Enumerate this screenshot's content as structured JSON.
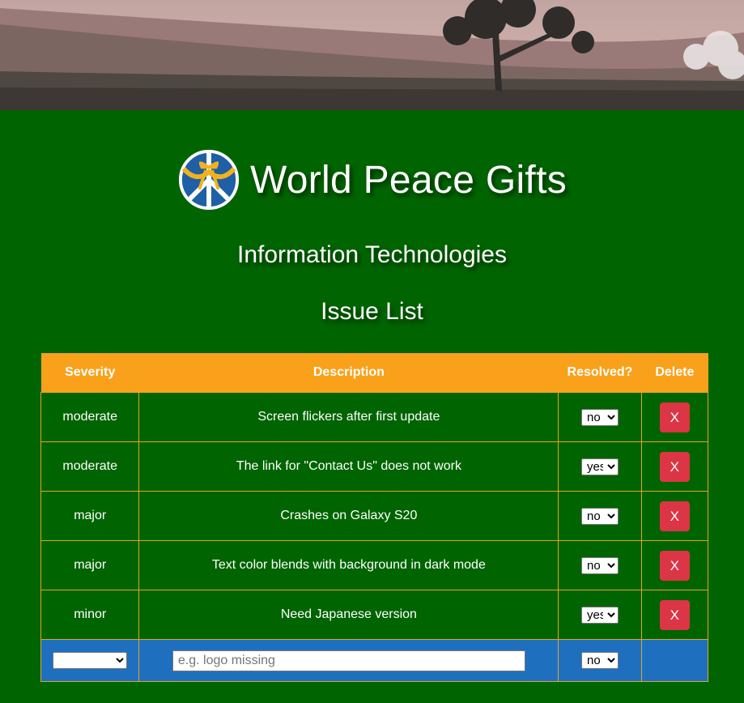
{
  "brand": {
    "title": "World Peace Gifts",
    "logo_icon": "peace-ribbon-logo-icon"
  },
  "header": {
    "subtitle": "Information Technologies",
    "section_title": "Issue List"
  },
  "table": {
    "columns": {
      "severity": "Severity",
      "description": "Description",
      "resolved": "Resolved?",
      "delete": "Delete"
    },
    "rows": [
      {
        "severity": "moderate",
        "description": "Screen flickers after first update",
        "resolved": "no",
        "delete_label": "X"
      },
      {
        "severity": "moderate",
        "description": "The link for \"Contact Us\" does not work",
        "resolved": "yes",
        "delete_label": "X"
      },
      {
        "severity": "major",
        "description": "Crashes on Galaxy S20",
        "resolved": "no",
        "delete_label": "X"
      },
      {
        "severity": "major",
        "description": "Text color blends with background in dark mode",
        "resolved": "no",
        "delete_label": "X"
      },
      {
        "severity": "minor",
        "description": "Need Japanese version",
        "resolved": "yes",
        "delete_label": "X"
      }
    ],
    "new_row": {
      "severity_value": "",
      "description_placeholder": "e.g. logo missing",
      "resolved_value": "no"
    }
  },
  "colors": {
    "page_bg": "#006400",
    "header_bg": "#f9a11b",
    "border": "#e0a526",
    "delete_btn": "#dc3545",
    "new_row_bg": "#1f6fbf"
  }
}
